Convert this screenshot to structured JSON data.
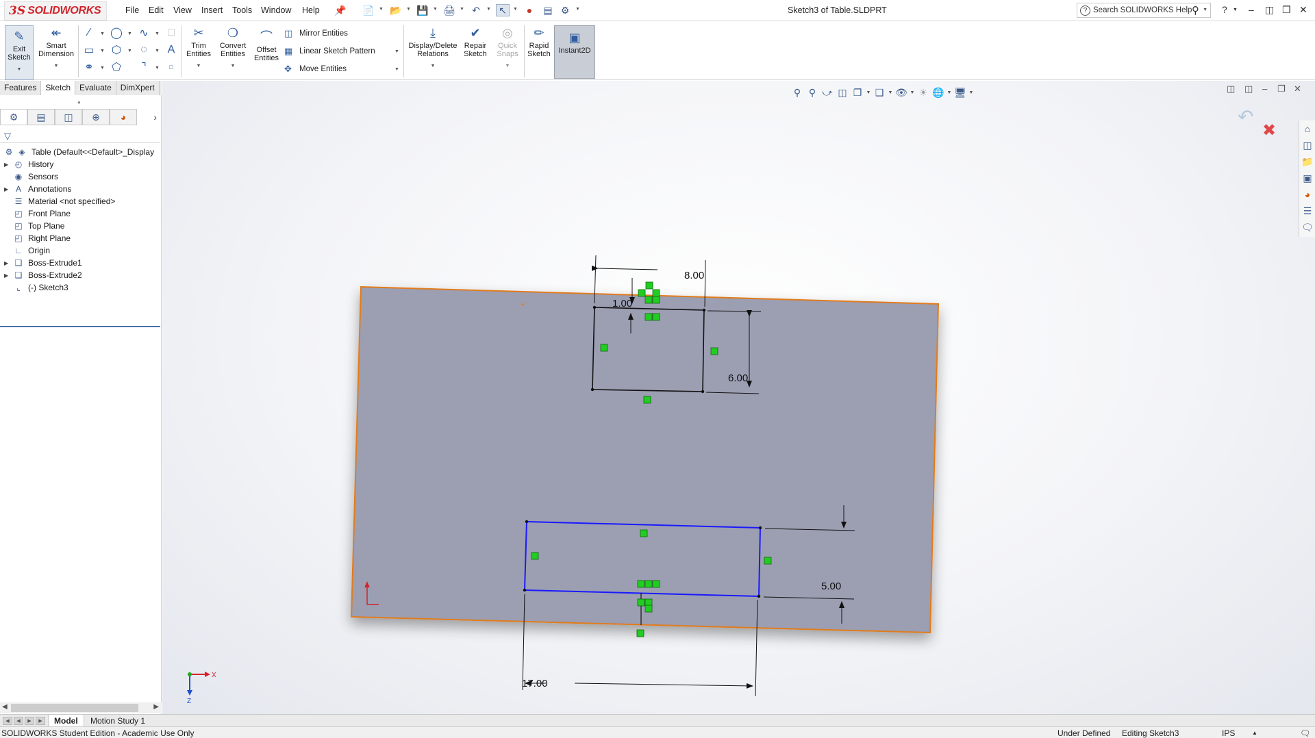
{
  "app": {
    "brand_ds": "3S",
    "brand_name": "SOLIDWORKS",
    "doc_title": "Sketch3 of Table.SLDPRT"
  },
  "menu": [
    "File",
    "Edit",
    "View",
    "Insert",
    "Tools",
    "Window",
    "Help"
  ],
  "search": {
    "placeholder": "Search SOLIDWORKS Help"
  },
  "commands": {
    "exit_sketch": "Exit Sketch",
    "smart_dimension": "Smart Dimension",
    "trim_entities": "Trim Entities",
    "convert_entities": "Convert Entities",
    "offset_entities": "Offset Entities",
    "mirror_entities": "Mirror Entities",
    "linear_sketch_pattern": "Linear Sketch Pattern",
    "move_entities": "Move Entities",
    "display_delete_relations": "Display/Delete Relations",
    "repair_sketch": "Repair Sketch",
    "quick_snaps": "Quick Snaps",
    "rapid_sketch": "Rapid Sketch",
    "instant2d": "Instant2D"
  },
  "command_tabs": [
    {
      "label": "Features",
      "active": false
    },
    {
      "label": "Sketch",
      "active": true
    },
    {
      "label": "Evaluate",
      "active": false
    },
    {
      "label": "DimXpert",
      "active": false
    }
  ],
  "tree": {
    "root": "Table  (Default<<Default>_Display",
    "items": [
      {
        "label": "History",
        "expandable": true,
        "icon": "history-icon"
      },
      {
        "label": "Sensors",
        "expandable": false,
        "icon": "sensors-icon"
      },
      {
        "label": "Annotations",
        "expandable": true,
        "icon": "annotations-icon"
      },
      {
        "label": "Material <not specified>",
        "expandable": false,
        "icon": "material-icon"
      },
      {
        "label": "Front Plane",
        "expandable": false,
        "icon": "plane-icon"
      },
      {
        "label": "Top Plane",
        "expandable": false,
        "icon": "plane-icon"
      },
      {
        "label": "Right Plane",
        "expandable": false,
        "icon": "plane-icon"
      },
      {
        "label": "Origin",
        "expandable": false,
        "icon": "origin-icon"
      },
      {
        "label": "Boss-Extrude1",
        "expandable": true,
        "icon": "extrude-icon"
      },
      {
        "label": "Boss-Extrude2",
        "expandable": true,
        "icon": "extrude-icon"
      },
      {
        "label": "(-) Sketch3",
        "expandable": false,
        "icon": "sketch-icon"
      }
    ]
  },
  "bottom_tabs": [
    {
      "label": "Model",
      "active": true
    },
    {
      "label": "Motion Study 1",
      "active": false
    }
  ],
  "status": {
    "edition": "SOLIDWORKS Student Edition - Academic Use Only",
    "definition": "Under Defined",
    "editing": "Editing Sketch3",
    "units": "IPS"
  },
  "dimensions": {
    "d_top_width": "8.00",
    "d_top_offset": "1.00",
    "d_top_height": "6.00",
    "d_bottom_height": "5.00",
    "d_bottom_width": "17.00"
  },
  "triad": {
    "x": "X",
    "z": "Z"
  },
  "colors": {
    "face": "#9c9eb2",
    "edge": "#e07b1e",
    "selected_line": "#1a1aff",
    "relation": "#22cc22",
    "accent_red": "#d2232a"
  }
}
